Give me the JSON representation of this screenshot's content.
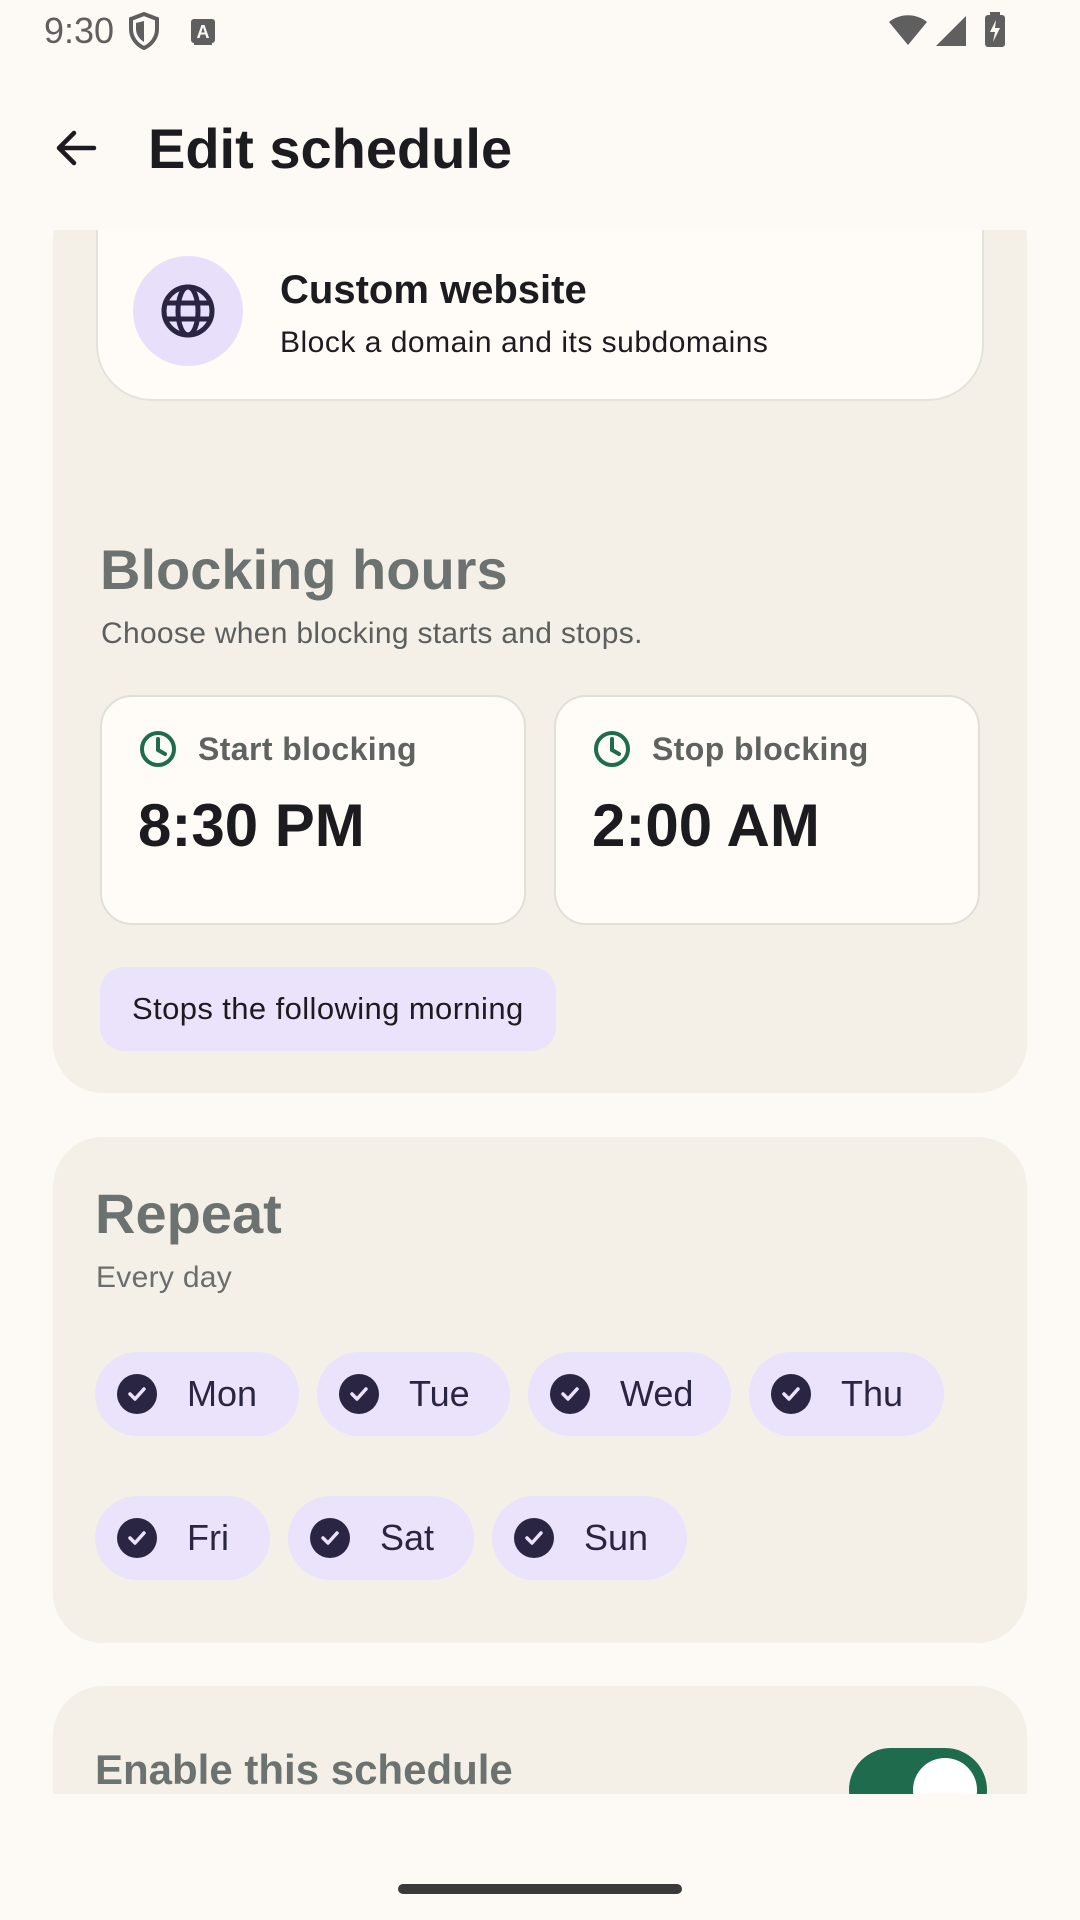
{
  "status_bar": {
    "time": "9:30",
    "left_icons": [
      "shield-icon",
      "keyboard-a-icon"
    ],
    "right_icons": [
      "wifi-icon",
      "cellular-signal-icon",
      "battery-charging-icon"
    ]
  },
  "app_bar": {
    "back_icon": "arrow-back-icon",
    "title": "Edit schedule"
  },
  "blocked_item": {
    "icon": "globe-icon",
    "title": "Custom website",
    "subtitle": "Block a domain and its subdomains"
  },
  "blocking_hours": {
    "title": "Blocking hours",
    "subtitle": "Choose when blocking starts and stops.",
    "start": {
      "icon": "clock-icon",
      "label": "Start blocking",
      "value": "8:30 PM"
    },
    "stop": {
      "icon": "clock-icon",
      "label": "Stop blocking",
      "value": "2:00 AM"
    },
    "note": "Stops the following morning"
  },
  "repeat": {
    "title": "Repeat",
    "subtitle": "Every day",
    "days": [
      {
        "label": "Mon",
        "selected": true
      },
      {
        "label": "Tue",
        "selected": true
      },
      {
        "label": "Wed",
        "selected": true
      },
      {
        "label": "Thu",
        "selected": true
      },
      {
        "label": "Fri",
        "selected": true
      },
      {
        "label": "Sat",
        "selected": true
      },
      {
        "label": "Sun",
        "selected": true
      }
    ]
  },
  "enable": {
    "label": "Enable this schedule",
    "enabled": true
  },
  "colors": {
    "background": "#fdf9f4",
    "card": "#f4f0e8",
    "chip": "#ebe3fb",
    "accent_green": "#1f6b4e",
    "clock_green": "#1f6b4e"
  }
}
